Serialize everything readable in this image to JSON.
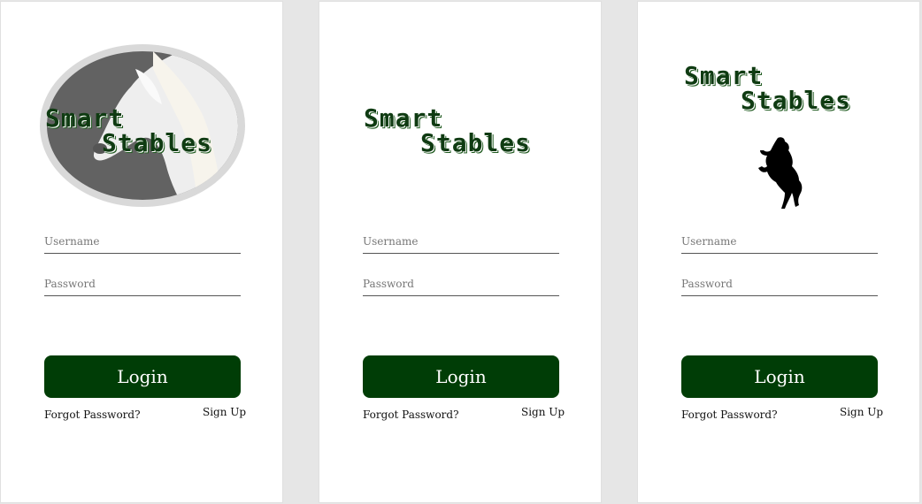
{
  "panels": [
    {
      "logo": {
        "line1": "Smart",
        "line2": "Stables",
        "image": "white-horse-photo"
      },
      "username_placeholder": "Username",
      "password_placeholder": "Password",
      "login_label": "Login",
      "forgot_label": "Forgot Password?",
      "signup_label": "Sign Up"
    },
    {
      "logo": {
        "line1": "Smart",
        "line2": "Stables"
      },
      "username_placeholder": "Username",
      "password_placeholder": "Password",
      "login_label": "Login",
      "forgot_label": "Forgot Password?",
      "signup_label": "Sign Up"
    },
    {
      "logo": {
        "line1": "Smart",
        "line2": "Stables",
        "image": "rearing-horse-silhouette"
      },
      "username_placeholder": "Username",
      "password_placeholder": "Password",
      "login_label": "Login",
      "forgot_label": "Forgot Password?",
      "signup_label": "Sign Up"
    }
  ],
  "colors": {
    "brand_green": "#003d06",
    "logo_green": "#0f3b12",
    "background": "#e6e6e6",
    "panel": "#ffffff"
  }
}
